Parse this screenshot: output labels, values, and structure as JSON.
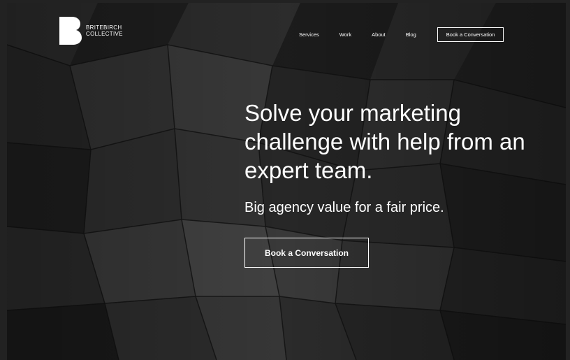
{
  "brand": {
    "line1": "BRITEBIRCH",
    "line2": "COLLECTIVE",
    "logo_icon": "b-logo-mark"
  },
  "nav": {
    "items": [
      {
        "label": "Services"
      },
      {
        "label": "Work"
      },
      {
        "label": "About"
      },
      {
        "label": "Blog"
      }
    ],
    "cta_label": "Book a Conversation"
  },
  "hero": {
    "headline": "Solve your marketing challenge with help from an expert team.",
    "subhead": "Big agency value for a fair price.",
    "cta_label": "Book a Conversation"
  },
  "colors": {
    "text": "#ffffff",
    "background": "#1c1c1c"
  }
}
